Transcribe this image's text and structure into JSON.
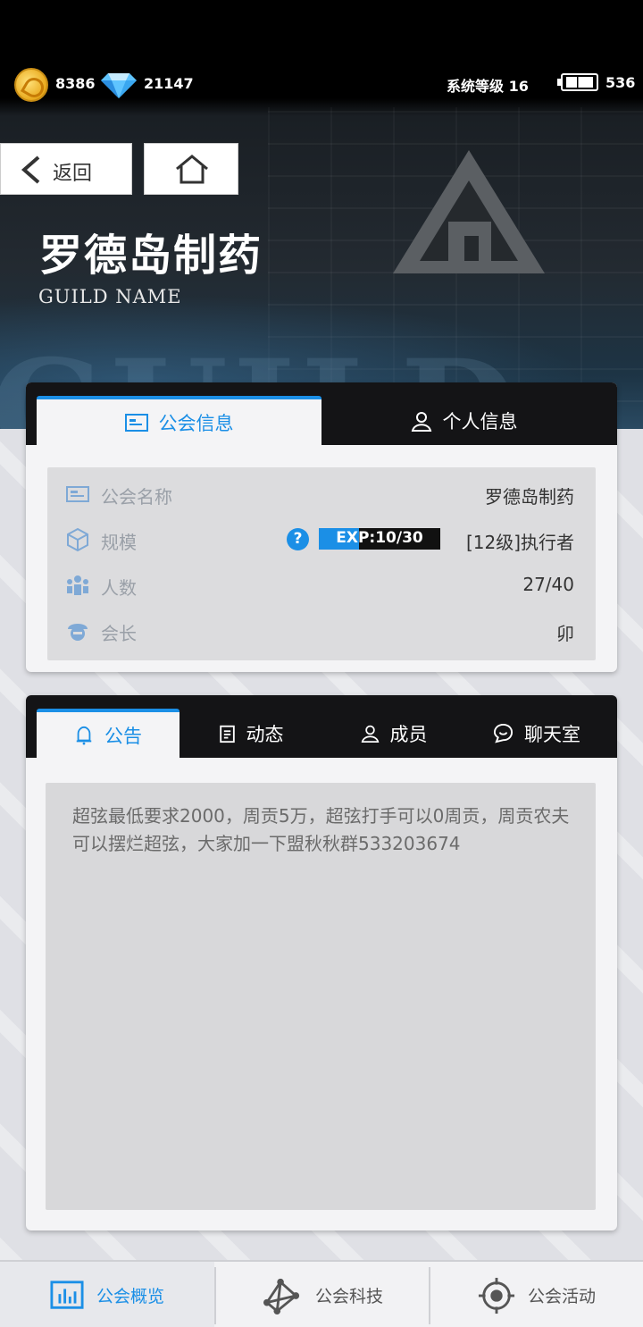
{
  "status": {
    "coins": "8386",
    "gems": "21147",
    "system_level": "系统等级 16",
    "energy": "536"
  },
  "nav": {
    "back_label": "返回"
  },
  "guild": {
    "title": "罗德岛制药",
    "subtitle": "GUILD NAME",
    "watermark": "GUILD"
  },
  "info_tabs": [
    {
      "label": "公会信息",
      "icon": "id-card-icon",
      "active": true
    },
    {
      "label": "个人信息",
      "icon": "person-icon",
      "active": false
    }
  ],
  "info_rows": {
    "name": {
      "key": "公会名称",
      "value": "罗德岛制药"
    },
    "scale": {
      "key": "规模",
      "exp_text": "EXP:10/30",
      "exp_progress": 0.333,
      "rank": "[12级]执行者"
    },
    "members": {
      "key": "人数",
      "value": "27/40"
    },
    "leader": {
      "key": "会长",
      "value": "卯"
    }
  },
  "ann_tabs": [
    {
      "label": "公告",
      "icon": "bell-icon",
      "active": true
    },
    {
      "label": "动态",
      "icon": "clipboard-icon",
      "active": false
    },
    {
      "label": "成员",
      "icon": "member-icon",
      "active": false
    },
    {
      "label": "聊天室",
      "icon": "chat-icon",
      "active": false
    }
  ],
  "announcement": "超弦最低要求2000，周贡5万，超弦打手可以0周贡，周贡农夫可以摆烂超弦，大家加一下盟秋秋群533203674",
  "bottom_nav": [
    {
      "label": "公会概览",
      "icon": "chart-icon",
      "active": true
    },
    {
      "label": "公会科技",
      "icon": "network-icon",
      "active": false
    },
    {
      "label": "公会活动",
      "icon": "target-icon",
      "active": false
    }
  ],
  "colors": {
    "accent": "#1b8fe6",
    "tab_dark": "#141416"
  }
}
